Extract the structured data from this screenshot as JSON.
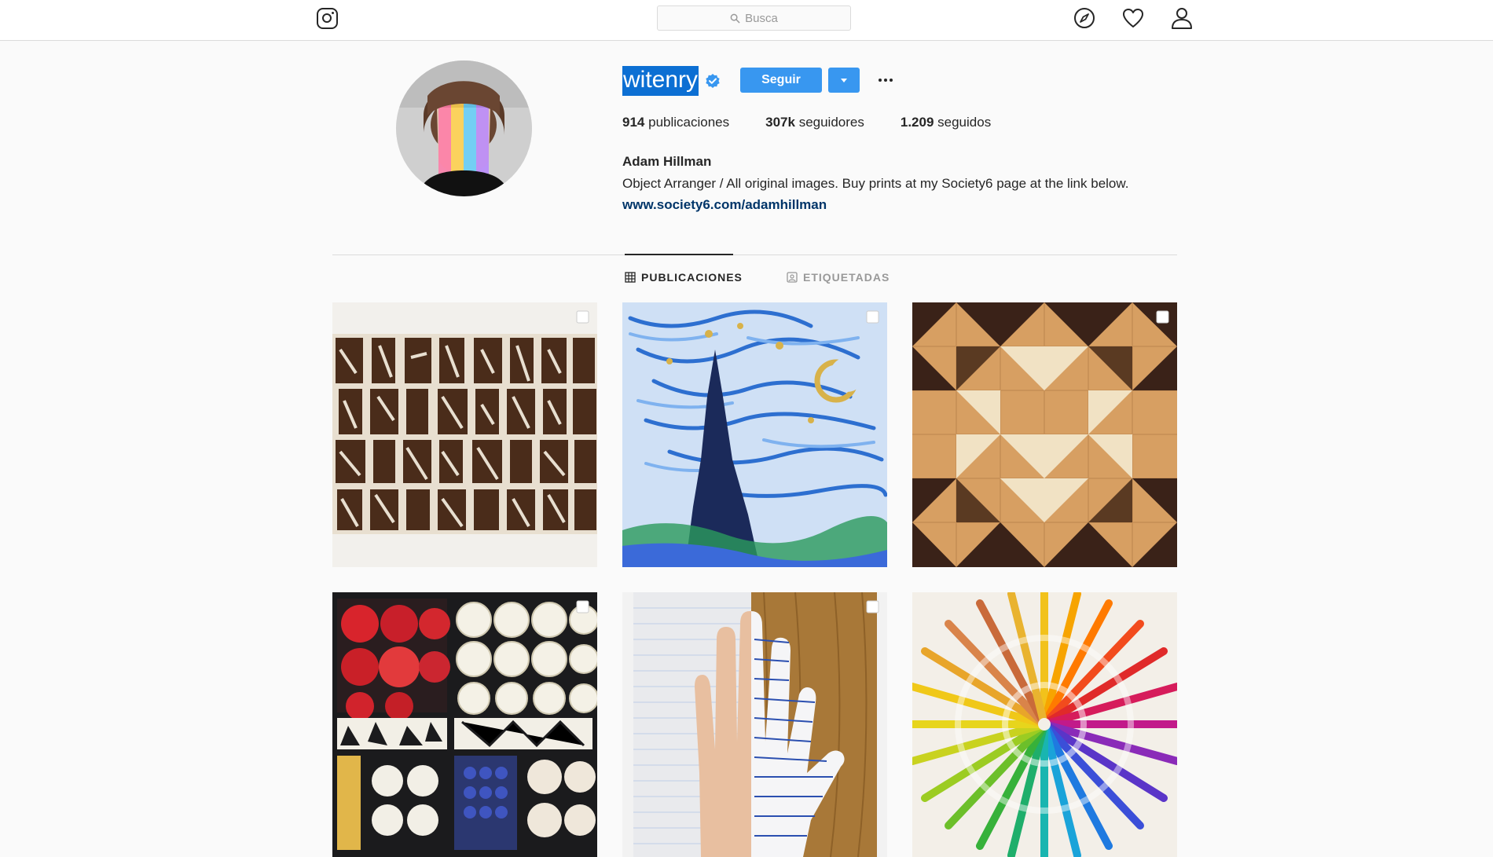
{
  "search": {
    "placeholder": "Busca"
  },
  "profile": {
    "username": "witenry",
    "follow_label": "Seguir",
    "stats": [
      {
        "count": "914",
        "label": "publicaciones"
      },
      {
        "count": "307k",
        "label": "seguidores"
      },
      {
        "count": "1.209",
        "label": "seguidos"
      }
    ],
    "full_name": "Adam Hillman",
    "bio": "Object Arranger / All original images. Buy prints at my Society6 page at the link below.",
    "link": "www.society6.com/adamhillman"
  },
  "tabs": [
    {
      "label": "PUBLICACIONES",
      "active": true
    },
    {
      "label": "ETIQUETADAS",
      "active": false
    }
  ],
  "colors": {
    "accent": "#3897f0",
    "link": "#003569",
    "selection": "#0c6fd3"
  }
}
